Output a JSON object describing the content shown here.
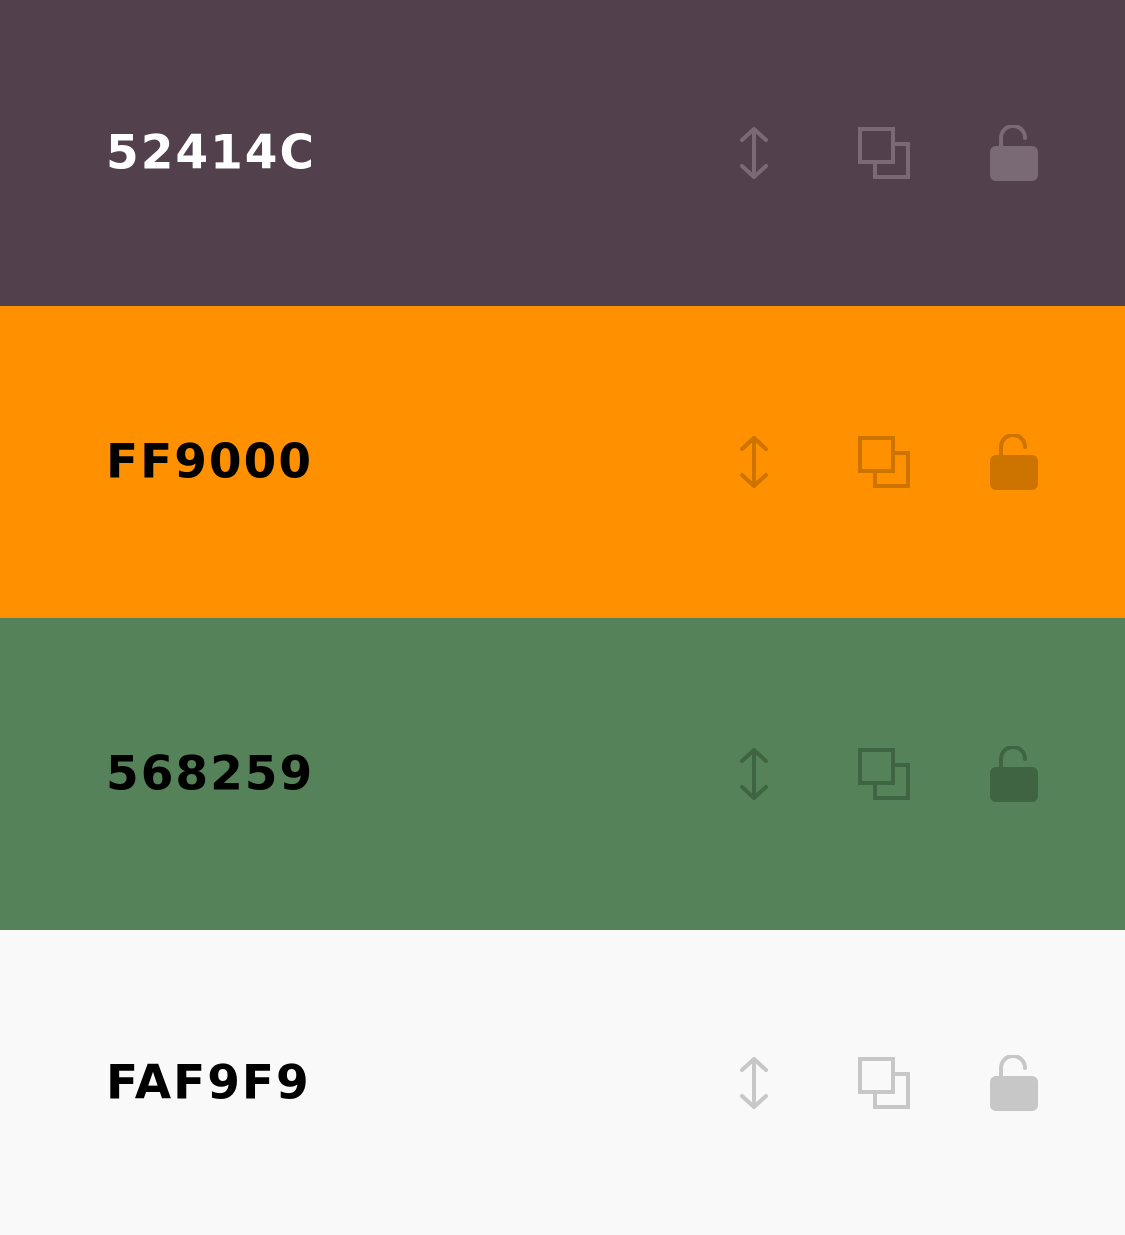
{
  "swatches": [
    {
      "hex": "52414C",
      "bg": "#52414C",
      "text_color": "#FFFFFF",
      "icon_color": "#7A6A75"
    },
    {
      "hex": "FF9000",
      "bg": "#FF9000",
      "text_color": "#000000",
      "icon_color": "#CC7300"
    },
    {
      "hex": "568259",
      "bg": "#568259",
      "text_color": "#000000",
      "icon_color": "#3F6442"
    },
    {
      "hex": "FAF9F9",
      "bg": "#FAF9F9",
      "text_color": "#000000",
      "icon_color": "#C8C7C7"
    }
  ],
  "icons": {
    "drag": "drag-reorder-icon",
    "copy": "copy-icon",
    "lock": "unlocked-padlock-icon"
  }
}
